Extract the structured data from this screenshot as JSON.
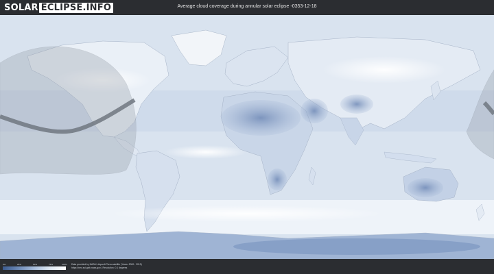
{
  "header": {
    "logo_part1": "SOLAR",
    "logo_part2": "ECLIPSE.INFO",
    "title": "Average cloud coverage during annular solar eclipse -0353-12-18"
  },
  "legend": {
    "ticks": [
      "0%",
      "25%",
      "50%",
      "75%",
      "100%"
    ],
    "colors": [
      "#3b5a8f",
      "#6d8ab7",
      "#a7bddb",
      "#dfe8f3",
      "#ffffff"
    ]
  },
  "footer": {
    "credit_line1": "Data provided by NASA's Aqua & Terra satellite (Years: 2000 - 2019)",
    "credit_line2": "https://neo.sci.gsfc.nasa.gov | Resolution: 0.1 degrees"
  },
  "map": {
    "ocean_color": "#dce6f1",
    "land_cloudy_color": "#f3f6fa",
    "clear_sky_color": "#5a76a8",
    "eclipse_band_color": "#8f949b"
  }
}
